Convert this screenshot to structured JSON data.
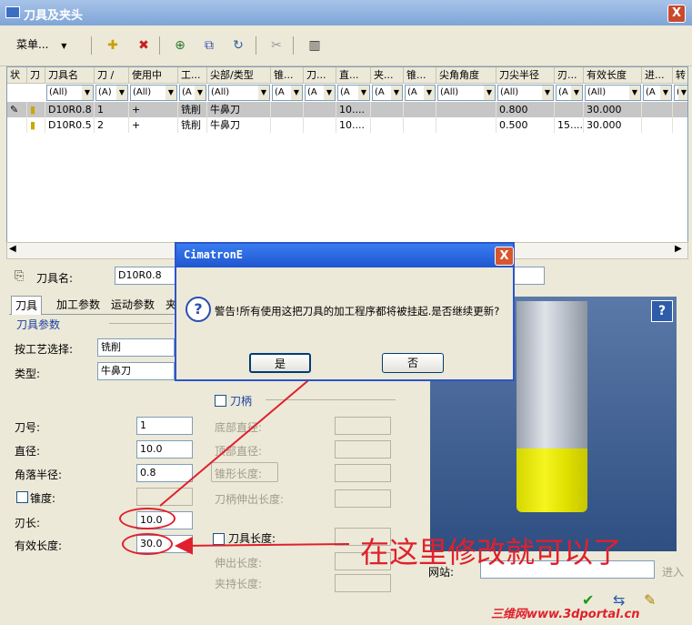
{
  "window": {
    "title": "刀具及夹头",
    "close_label": "X"
  },
  "toolbar": {
    "menu_label": "菜单...",
    "menu_arrow": "▼"
  },
  "table": {
    "headers": [
      "状",
      "刀",
      "刀具名",
      "刀 ∕",
      "使用中",
      "工...",
      "尖部/类型",
      "锥...",
      "刀...",
      "直...",
      "夹...",
      "锥...",
      "尖角角度",
      "刀尖半径",
      "刃...",
      "有效长度",
      "进...",
      "转"
    ],
    "filters": [
      "",
      "",
      "(All)",
      "(A)",
      "(All)",
      "(A",
      "(All)",
      "(A",
      "(A",
      "(A",
      "(A",
      "(A",
      "(All)",
      "(All)",
      "(A",
      "(All)",
      "(A",
      "("
    ],
    "rows": [
      [
        "✎",
        "▮",
        "D10R0.8",
        "1",
        "+",
        "铣削",
        "牛鼻刀",
        "",
        "",
        "10....",
        "",
        "",
        "",
        "0.800",
        "",
        "30.000",
        "",
        ""
      ],
      [
        "",
        "▮",
        "D10R0.5",
        "2",
        "+",
        "铣削",
        "牛鼻刀",
        "",
        "",
        "10....",
        "",
        "",
        "",
        "0.500",
        "15....",
        "30.000",
        "",
        ""
      ]
    ]
  },
  "tool": {
    "name_label": "刀具名:",
    "name_value": "D10R0.8",
    "tabs": [
      "刀具",
      "加工参数",
      "运动参数",
      "夹"
    ],
    "section": "刀具参数",
    "process_label": "按工艺选择:",
    "process_value": "铣削",
    "type_label": "类型:",
    "type_value": "牛鼻刀",
    "number_label": "刀号:",
    "number_value": "1",
    "diameter_label": "直径:",
    "diameter_value": "10.0",
    "corner_label": "角落半径:",
    "corner_value": "0.8",
    "taper_label": "锥度:",
    "flute_label": "刃长:",
    "flute_value": "10.0",
    "eff_label": "有效长度:",
    "eff_value": "30.0"
  },
  "holder": {
    "label": "刀柄",
    "bottom_dia": "底部直径:",
    "top_dia": "顶部直径:",
    "cone_len": "锥形长度:",
    "ext_len": "刀柄伸出长度:"
  },
  "tool_length": {
    "label": "刀具长度:",
    "ext": "伸出长度:",
    "clamp": "夹持长度:"
  },
  "web": {
    "label": "网站:",
    "go": "进入"
  },
  "dialog": {
    "title": "CimatronE",
    "close_label": "X",
    "icon": "?",
    "message": "警告!所有使用这把刀具的加工程序都将被挂起.是否继续更新?",
    "yes": "是",
    "no": "否"
  },
  "annotation": {
    "text": "在这里修改就可以了"
  },
  "watermark": "三维网www.3dportal.cn"
}
